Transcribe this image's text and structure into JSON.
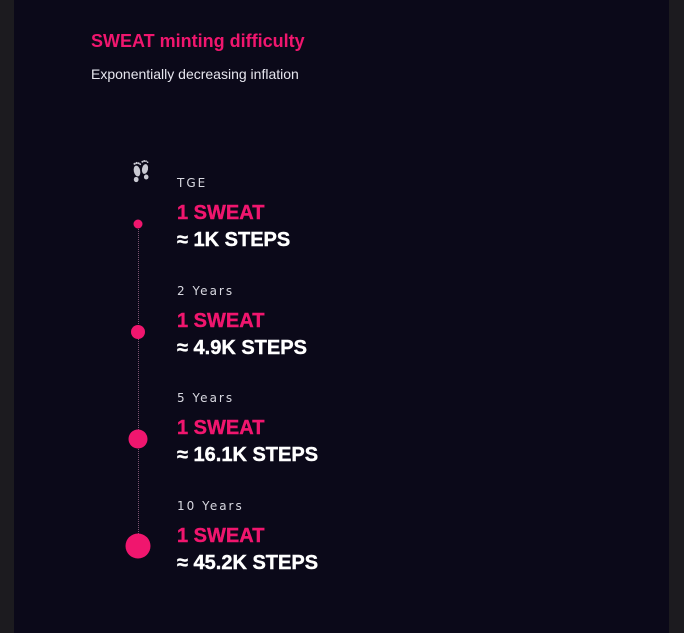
{
  "header": {
    "title": "SWEAT minting difficulty",
    "subtitle": "Exponentially decreasing inflation"
  },
  "icon": "footprints-icon",
  "colors": {
    "accent": "#f0166e",
    "background": "#0b0919",
    "text": "#ffffff"
  },
  "milestones": [
    {
      "label": "TGE",
      "reward": "1 SWEAT",
      "steps": "≈ 1K STEPS"
    },
    {
      "label": "2 Years",
      "reward": "1 SWEAT",
      "steps": "≈ 4.9K STEPS"
    },
    {
      "label": "5 Years",
      "reward": "1 SWEAT",
      "steps": "≈ 16.1K STEPS"
    },
    {
      "label": "10 Years",
      "reward": "1 SWEAT",
      "steps": "≈ 45.2K STEPS"
    }
  ]
}
